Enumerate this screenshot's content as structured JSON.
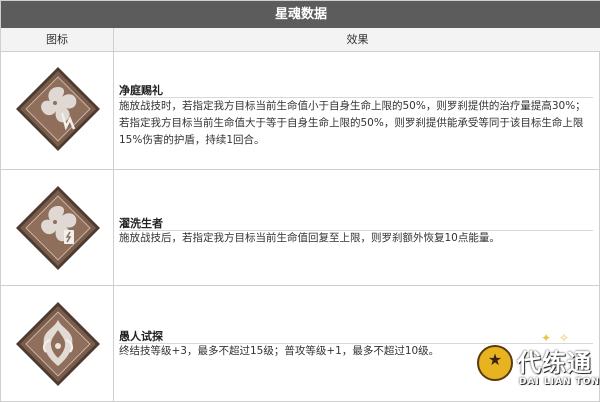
{
  "title": "星魂数据",
  "columns": {
    "icon": "图标",
    "effect": "效果"
  },
  "rows": [
    {
      "name": "净庭赐礼",
      "desc": "施放战技时，若指定我方目标当前生命值小于自身生命上限的50%，则罗刹提供的治疗量提高30%；若指定我方目标当前生命值大于等于自身生命上限的50%，则罗刹提供能承受等同于该目标生命上限15%伤害的护盾，持续1回合。",
      "icon": "flower-claw-emblem-icon"
    },
    {
      "name": "濯洗生者",
      "desc": "施放战技后，若指定我方目标当前生命值回复至上限，则罗刹额外恢复10点能量。",
      "icon": "flower-bolt-emblem-icon"
    },
    {
      "name": "愚人试探",
      "desc": "终结技等级+3，最多不超过15级；普攻等级+1，最多不超过10级。",
      "icon": "flame-crest-emblem-icon"
    }
  ],
  "watermark": {
    "text": "代练通",
    "sub": "DAI LIAN TONG"
  },
  "colors": {
    "title_bg": "#5c5c5c",
    "header_bg": "#f3f3f3",
    "border": "#cfcfcf",
    "diamond_outer": "#6e5344",
    "diamond_inner": "#8c6d5a"
  }
}
